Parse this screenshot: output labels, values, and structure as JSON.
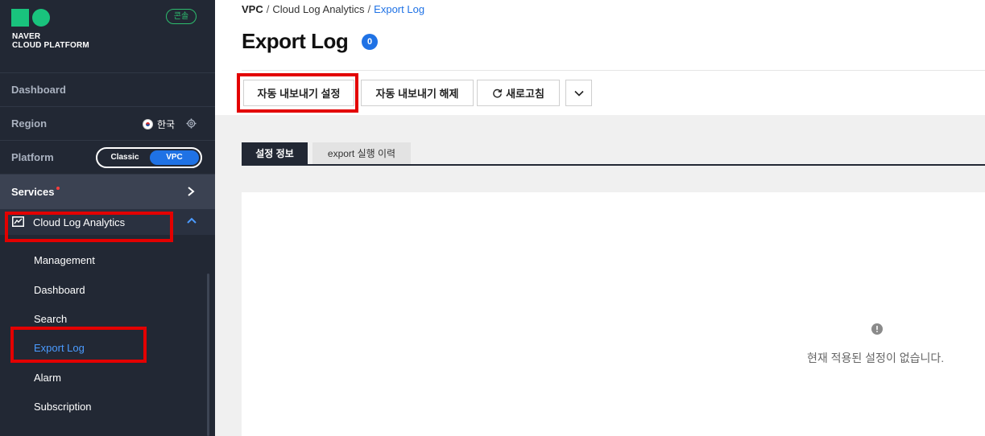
{
  "sidebar": {
    "logo_text_line1": "NAVER",
    "logo_text_line2": "CLOUD PLATFORM",
    "console_badge": "콘솔",
    "dashboard_label": "Dashboard",
    "region_label": "Region",
    "region_value": "한국",
    "platform_label": "Platform",
    "platform_options": [
      "Classic",
      "VPC"
    ],
    "platform_selected": "VPC",
    "services_label": "Services",
    "service_group": "Cloud Log Analytics",
    "service_items": [
      "Management",
      "Dashboard",
      "Search",
      "Export Log",
      "Alarm",
      "Subscription"
    ],
    "active_item": "Export Log"
  },
  "breadcrumb": [
    "VPC",
    "Cloud Log Analytics",
    "Export Log"
  ],
  "page": {
    "title": "Export Log",
    "count": "0"
  },
  "toolbar": {
    "auto_export_label": "자동 내보내기 설정",
    "auto_export_release_label": "자동 내보내기 해제",
    "refresh_label": "새로고침"
  },
  "tabs": [
    "설정 정보",
    "export 실행 이력"
  ],
  "empty_message": "현재 적용된 설정이 없습니다.",
  "colors": {
    "sidebar_bg": "#222834",
    "accent": "#1f72e5",
    "highlight": "#e30000",
    "console_green": "#2dbd6e"
  }
}
